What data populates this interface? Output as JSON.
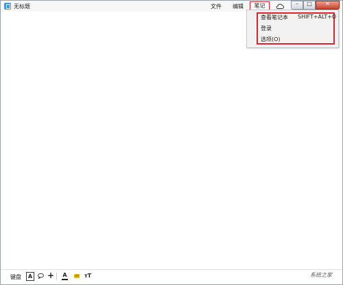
{
  "window": {
    "title": "无标题"
  },
  "menu": {
    "file": "文件",
    "edit": "编辑",
    "notes": "笔记",
    "cloud_icon": "cloud-icon"
  },
  "dropdown": {
    "items": [
      {
        "label": "查看笔记本",
        "shortcut": "SHIFT+ALT+O"
      },
      {
        "label": "登录"
      },
      {
        "label": "选项(O)"
      }
    ]
  },
  "statusbar": {
    "label": "键盘",
    "font_button": "A",
    "text_color_glyph": "A",
    "highlight_glyph": "ab",
    "font_size_glyph": "тT"
  },
  "watermark": "系统之家"
}
